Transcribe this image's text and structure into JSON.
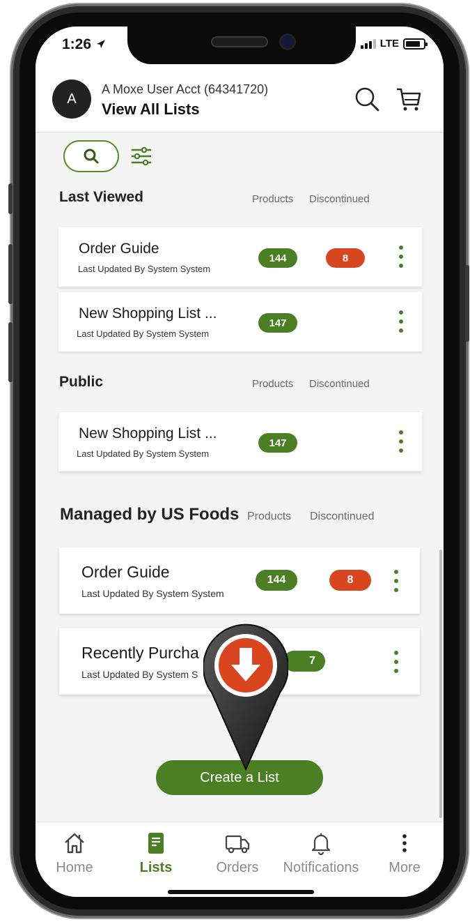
{
  "status_bar": {
    "time": "1:26",
    "network": "LTE"
  },
  "header": {
    "avatar_initial": "A",
    "account_name": "A Moxe User Acct (64341720)",
    "title": "View All Lists",
    "icons": [
      "search-icon",
      "cart-icon"
    ]
  },
  "filters": {
    "search_icon": "search-icon",
    "filter_icon": "sliders-icon"
  },
  "columns": {
    "products": "Products",
    "discontinued": "Discontinued"
  },
  "sections": {
    "last_viewed": {
      "title": "Last Viewed",
      "items": [
        {
          "name": "Order Guide",
          "updated": "Last Updated By  System System",
          "products": "144",
          "discontinued": "8"
        },
        {
          "name": "New Shopping List ...",
          "updated": "Last Updated By  System System",
          "products": "147"
        }
      ]
    },
    "public": {
      "title": "Public",
      "items": [
        {
          "name": "New Shopping List ...",
          "updated": "Last Updated By  System System",
          "products": "147"
        }
      ]
    },
    "managed": {
      "title": "Managed by US Foods",
      "items": [
        {
          "name": "Order Guide",
          "updated": "Last Updated By  System System",
          "products": "144",
          "discontinued": "8"
        },
        {
          "name": "Recently Purcha",
          "updated": "Last Updated By  System S",
          "products": "7"
        }
      ]
    }
  },
  "create_button": "Create a List",
  "bottom_nav": [
    {
      "label": "Home",
      "icon": "home-icon"
    },
    {
      "label": "Lists",
      "icon": "list-icon",
      "active": true
    },
    {
      "label": "Orders",
      "icon": "truck-icon"
    },
    {
      "label": "Notifications",
      "icon": "bell-icon"
    },
    {
      "label": "More",
      "icon": "more-vertical-icon"
    }
  ],
  "colors": {
    "brand_green": "#4b7f23",
    "alert_red": "#d9451f",
    "pin_accent": "#d9451f"
  }
}
